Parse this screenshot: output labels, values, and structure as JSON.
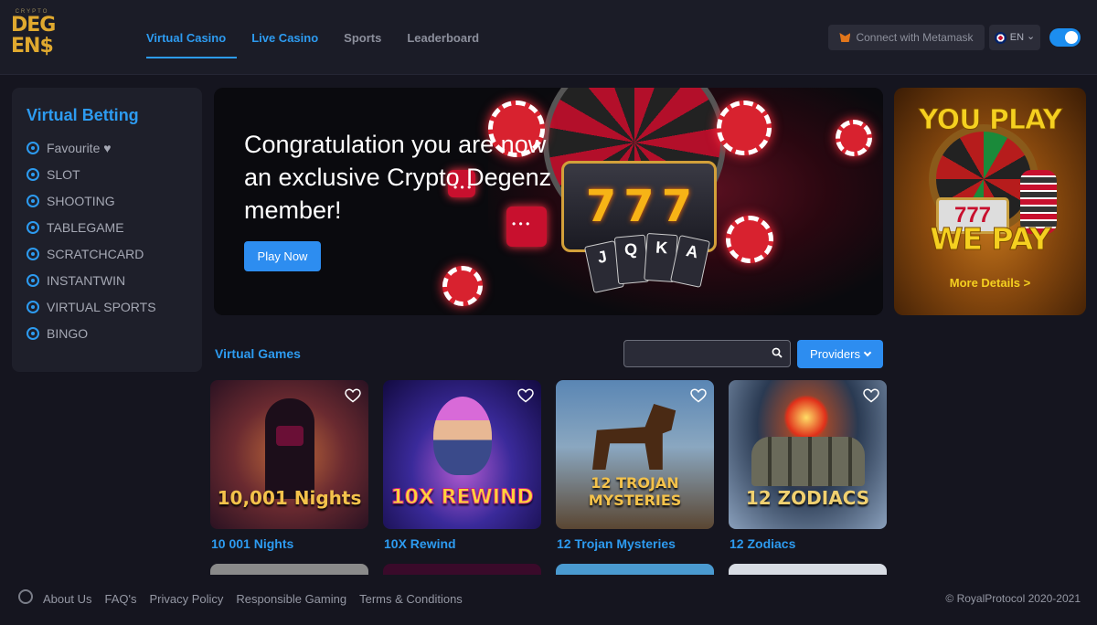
{
  "logo": {
    "tiny": "CRYPTO",
    "line1": "DEG",
    "line2": "EN$"
  },
  "nav": [
    {
      "label": "Virtual Casino",
      "active": true
    },
    {
      "label": "Live Casino",
      "active": false
    },
    {
      "label": "Sports",
      "active": false
    },
    {
      "label": "Leaderboard",
      "active": false
    }
  ],
  "header": {
    "connect_label": "Connect with Metamask",
    "lang_label": "EN",
    "lang_caret": "⌄"
  },
  "sidebar": {
    "title": "Virtual Betting",
    "items": [
      {
        "label": "Favourite ♥"
      },
      {
        "label": "SLOT"
      },
      {
        "label": "SHOOTING"
      },
      {
        "label": "TABLEGAME"
      },
      {
        "label": "SCRATCHCARD"
      },
      {
        "label": "INSTANTWIN"
      },
      {
        "label": "VIRTUAL SPORTS"
      },
      {
        "label": "BINGO"
      }
    ]
  },
  "banner": {
    "headline": "Congratulation you are now an exclusive Crypto Degenz member!",
    "cta": "Play Now",
    "slot_digits": [
      "7",
      "7",
      "7"
    ],
    "cards": [
      "J",
      "Q",
      "K",
      "A"
    ]
  },
  "promo": {
    "top": "YOU PLAY",
    "bottom": "WE PAY",
    "slot": "777",
    "link": "More Details >"
  },
  "games": {
    "section_title": "Virtual Games",
    "search": {
      "value": "",
      "placeholder": ""
    },
    "providers_label": "Providers",
    "items": [
      {
        "title": "10 001 Nights",
        "art_text": "10,001 Nights"
      },
      {
        "title": "10X Rewind",
        "art_text": "10X REWIND"
      },
      {
        "title": "12 Trojan Mysteries",
        "art_text": "12 TROJAN MYSTERIES"
      },
      {
        "title": "12 Zodiacs",
        "art_text": "12 ZODIACS"
      }
    ]
  },
  "footer": {
    "links": [
      "About Us",
      "FAQ's",
      "Privacy Policy",
      "Responsible Gaming",
      "Terms & Conditions"
    ],
    "copyright": "© RoyalProtocol 2020-2021"
  },
  "colors": {
    "accent": "#2d9bf0",
    "background": "#15151f",
    "gold": "#f5d020"
  }
}
